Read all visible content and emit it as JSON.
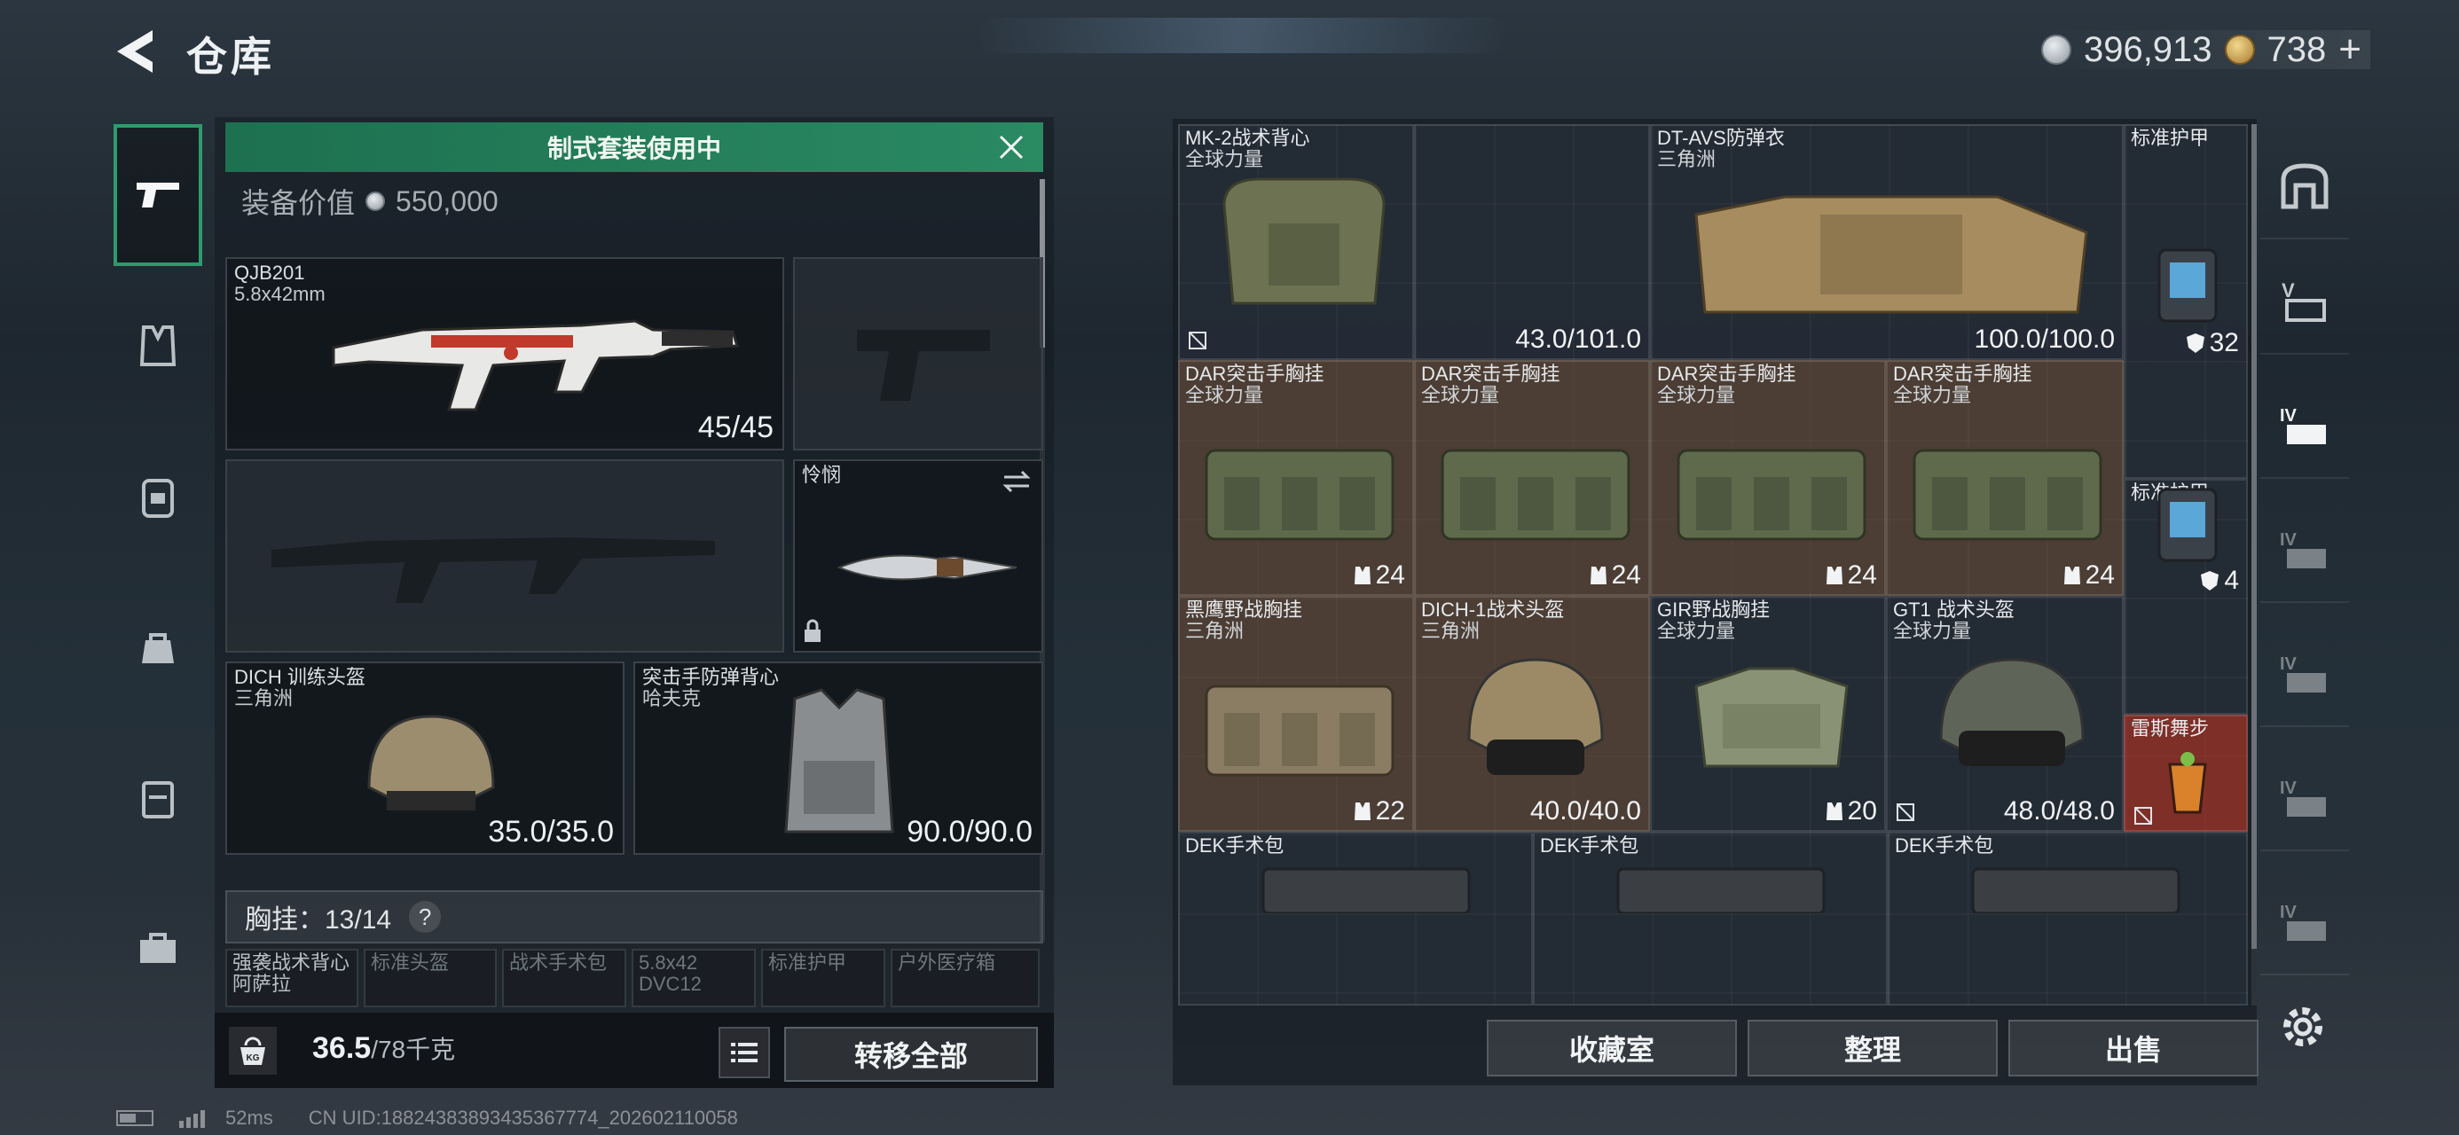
{
  "header": {
    "title": "仓库"
  },
  "currency": {
    "silver": "396,913",
    "gold": "738",
    "plus": "+"
  },
  "loadout": {
    "banner": "制式套装使用中",
    "value_label": "装备价值",
    "value": "550,000",
    "primary": {
      "name": "QJB201",
      "ammo": "5.8x42mm",
      "durability": "45/45"
    },
    "melee": {
      "name": "怜悯"
    },
    "helmet": {
      "name": "DICH 训练头盔",
      "faction": "三角洲",
      "durability": "35.0/35.0"
    },
    "armor": {
      "name": "突击手防弹背心",
      "faction": "哈夫克",
      "durability": "90.0/90.0"
    },
    "chest_label": "胸挂：13/14",
    "help": "?",
    "mini_slots": [
      {
        "label": "强袭战术背心",
        "sub": "阿萨拉"
      },
      {
        "label": "标准头盔",
        "sub": ""
      },
      {
        "label": "战术手术包",
        "sub": ""
      },
      {
        "label": "5.8x42",
        "sub": "DVC12"
      },
      {
        "label": "标准护甲",
        "sub": ""
      },
      {
        "label": "户外医疗箱",
        "sub": ""
      }
    ],
    "weight": "36.5",
    "weight_max": "/78千克",
    "kg": "KG",
    "transfer": "转移全部"
  },
  "stash": {
    "items": [
      {
        "name": "MK-2战术背心",
        "sub": "全球力量",
        "value": "43.0/101.0"
      },
      {
        "name": "DT-AVS防弹衣",
        "sub": "三角洲",
        "value": "100.0/100.0"
      },
      {
        "name": "标准护甲",
        "sub": "",
        "value": "32"
      },
      {
        "name": "DAR突击手胸挂",
        "sub": "全球力量",
        "value": "24"
      },
      {
        "name": "DAR突击手胸挂",
        "sub": "全球力量",
        "value": "24"
      },
      {
        "name": "DAR突击手胸挂",
        "sub": "全球力量",
        "value": "24"
      },
      {
        "name": "DAR突击手胸挂",
        "sub": "全球力量",
        "value": "24"
      },
      {
        "name": "标准护甲",
        "sub": "",
        "value": "4"
      },
      {
        "name": "黑鹰野战胸挂",
        "sub": "三角洲",
        "value": "22"
      },
      {
        "name": "DICH-1战术头盔",
        "sub": "三角洲",
        "value": "40.0/40.0"
      },
      {
        "name": "GIR野战胸挂",
        "sub": "全球力量",
        "value": "20"
      },
      {
        "name": "GT1 战术头盔",
        "sub": "全球力量",
        "value": "48.0/48.0"
      },
      {
        "name": "雷斯舞步",
        "sub": "",
        "value": ""
      },
      {
        "name": "DEK手术包",
        "sub": "",
        "value": ""
      },
      {
        "name": "DEK手术包",
        "sub": "",
        "value": ""
      },
      {
        "name": "DEK手术包",
        "sub": "",
        "value": ""
      }
    ],
    "buttons": {
      "collection": "收藏室",
      "sort": "整理",
      "sell": "出售"
    }
  },
  "status": {
    "ping": "52ms",
    "uid": "CN UID:18824383893435367774_202602110058"
  },
  "colors": {
    "accent": "#2a8a62",
    "item_brown": "#5c4838",
    "item_red": "#963228"
  }
}
